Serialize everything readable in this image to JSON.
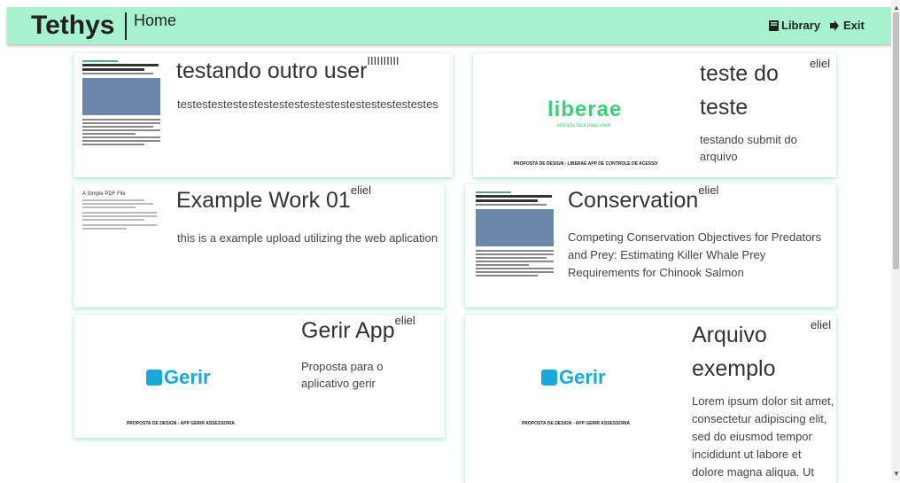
{
  "navbar": {
    "brand": "Tethys",
    "page": "Home",
    "library_label": "Library",
    "exit_label": "Exit"
  },
  "cards": [
    {
      "title": "testando outro user",
      "user": "IIIIIIIIII",
      "description": "testestestestestestestestestestestestestestestestes",
      "thumbnail": "paper-preview"
    },
    {
      "title": "teste do teste",
      "user": "eliel",
      "description": "testando submit do arquivo",
      "thumbnail": "liberae-preview",
      "thumb_logo": "liberae",
      "thumb_tagline": "entrada fácil para você",
      "thumb_caption": "PROPOSTA DE DESIGN - LIBERAE APP DE CONTROLE DE ACESSO"
    },
    {
      "title": "Example Work 01",
      "user": "eliel",
      "description": "this is a example upload utilizing the web aplication",
      "thumbnail": "simple-pdf-preview",
      "thumb_heading": "A Simple PDF File"
    },
    {
      "title": "Conservation",
      "user": "eliel",
      "description": "Competing Conservation Objectives for Predators and Prey: Estimating Killer Whale Prey Requirements for Chinook Salmon",
      "thumbnail": "paper-preview"
    },
    {
      "title": "Gerir App",
      "user": "eliel",
      "description": "Proposta para o aplicativo gerir",
      "thumbnail": "gerir-preview",
      "thumb_logo": "Gerir",
      "thumb_caption": "PROPOSTA DE DESIGN - APP GERIR ASSESSORIA"
    },
    {
      "title": "Arquivo exemplo",
      "user": "eliel",
      "description": "Lorem ipsum dolor sit amet, consectetur adipiscing elit, sed do eiusmod tempor incididunt ut labore et dolore magna aliqua. Ut enim ad minim veniam",
      "thumbnail": "gerir-preview",
      "thumb_logo": "Gerir",
      "thumb_caption": "PROPOSTA DE DESIGN - APP GERIR ASSESSORIA"
    }
  ],
  "colors": {
    "navbar": "#a6f2cf",
    "liberae_green": "#3ccf7a",
    "gerir_teal": "#1aa8d8"
  }
}
